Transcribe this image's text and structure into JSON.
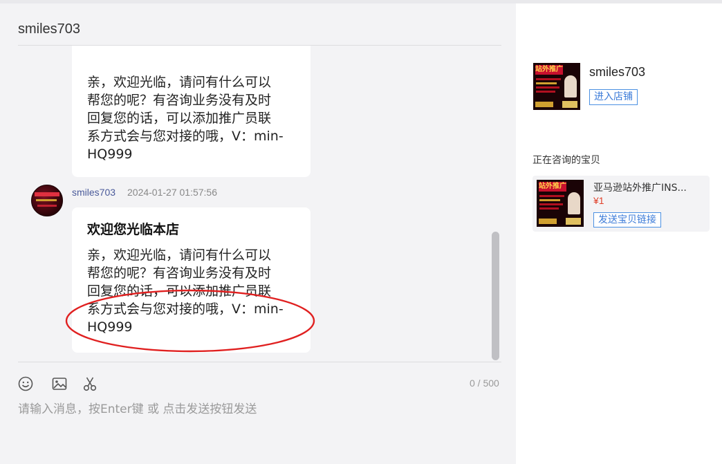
{
  "header": {
    "title": "smiles703"
  },
  "messages": [
    {
      "text": "亲，欢迎光临，请问有什么可以\n帮您的呢？有咨询业务没有及时\n回复您的话，可以添加推广员联\n系方式会与您对接的哦，V：min-\nHQ999"
    },
    {
      "sender": "smiles703",
      "timestamp": "2024-01-27 01:57:56",
      "title": "欢迎您光临本店",
      "text": "亲，欢迎光临，请问有什么可以\n帮您的呢？有咨询业务没有及时\n回复您的话，可以添加推广员联\n系方式会与您对接的哦，V：min-\nHQ999"
    }
  ],
  "input": {
    "placeholder": "请输入消息，按Enter键 或 点击发送按钮发送",
    "counter": "0 / 500"
  },
  "toolbar": {
    "icons": [
      "emoji-icon",
      "image-icon",
      "scissors-icon"
    ]
  },
  "shop": {
    "name": "smiles703",
    "enter_label": "进入店铺",
    "thumb_text": "站外推广"
  },
  "consulting": {
    "title": "正在咨询的宝贝",
    "product_name": "亚马逊站外推广INS...",
    "price": "¥1",
    "send_label": "发送宝贝链接"
  },
  "colors": {
    "accent": "#3a7ad8",
    "price": "#e0402a",
    "annotation": "#e02020"
  }
}
